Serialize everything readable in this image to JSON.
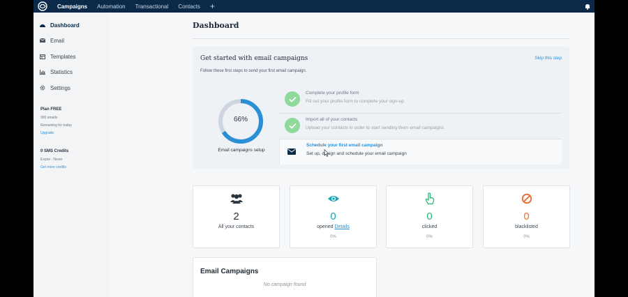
{
  "topnav": {
    "items": [
      "Campaigns",
      "Automation",
      "Transactional",
      "Contacts"
    ],
    "plus": "+"
  },
  "sidebar": {
    "items": [
      {
        "label": "Dashboard",
        "icon": "dashboard-icon"
      },
      {
        "label": "Email",
        "icon": "mail-icon"
      },
      {
        "label": "Templates",
        "icon": "templates-icon"
      },
      {
        "label": "Statistics",
        "icon": "statistics-icon"
      },
      {
        "label": "Settings",
        "icon": "gear-icon"
      }
    ],
    "plan": {
      "title": "Plan FREE",
      "emails": "300 emails",
      "remaining": "Remaining for today",
      "upgrade": "Upgrade"
    },
    "sms": {
      "title": "0 SMS Credits",
      "expire": "Expire : Never",
      "get_more": "Get more credits"
    }
  },
  "main": {
    "title": "Dashboard",
    "getting_started": {
      "title": "Get started with email campaigns",
      "subtitle": "Follow these first steps to send your first email campaign.",
      "skip": "Skip this step",
      "progress_percent": 66,
      "progress_label": "66%",
      "progress_caption": "Email campaigns setup",
      "steps": [
        {
          "title": "Complete your profile form",
          "desc": "Fill out your profile form to complete your sign-up",
          "done": true
        },
        {
          "title": "Import all of your contacts",
          "desc": "Upload your contacts in order to start sending them email campaigns",
          "done": true
        },
        {
          "title": "Schedule your first email campaign",
          "desc": "Set up, design and schedule your email campaign",
          "done": false
        }
      ]
    },
    "stats": [
      {
        "value": "2",
        "label": "All your contacts",
        "pct": "",
        "icon": "contacts-icon",
        "color": "#2b3540"
      },
      {
        "value": "0",
        "label": "opened",
        "link": "Details",
        "pct": "0%",
        "icon": "eye-icon",
        "color": "#1aa7b5"
      },
      {
        "value": "0",
        "label": "clicked",
        "pct": "0%",
        "icon": "pointer-hand-icon",
        "color": "#2bb673"
      },
      {
        "value": "0",
        "label": "blacklisted",
        "pct": "0%",
        "icon": "blocked-icon",
        "color": "#e8743b"
      }
    ],
    "email_campaigns": {
      "title": "Email Campaigns",
      "empty": "No campaign found"
    }
  },
  "colors": {
    "nav_bg": "#0b2a4a",
    "accent": "#2a8fd4",
    "check_green": "#8fd99a",
    "donut": "#2a8fd4"
  }
}
